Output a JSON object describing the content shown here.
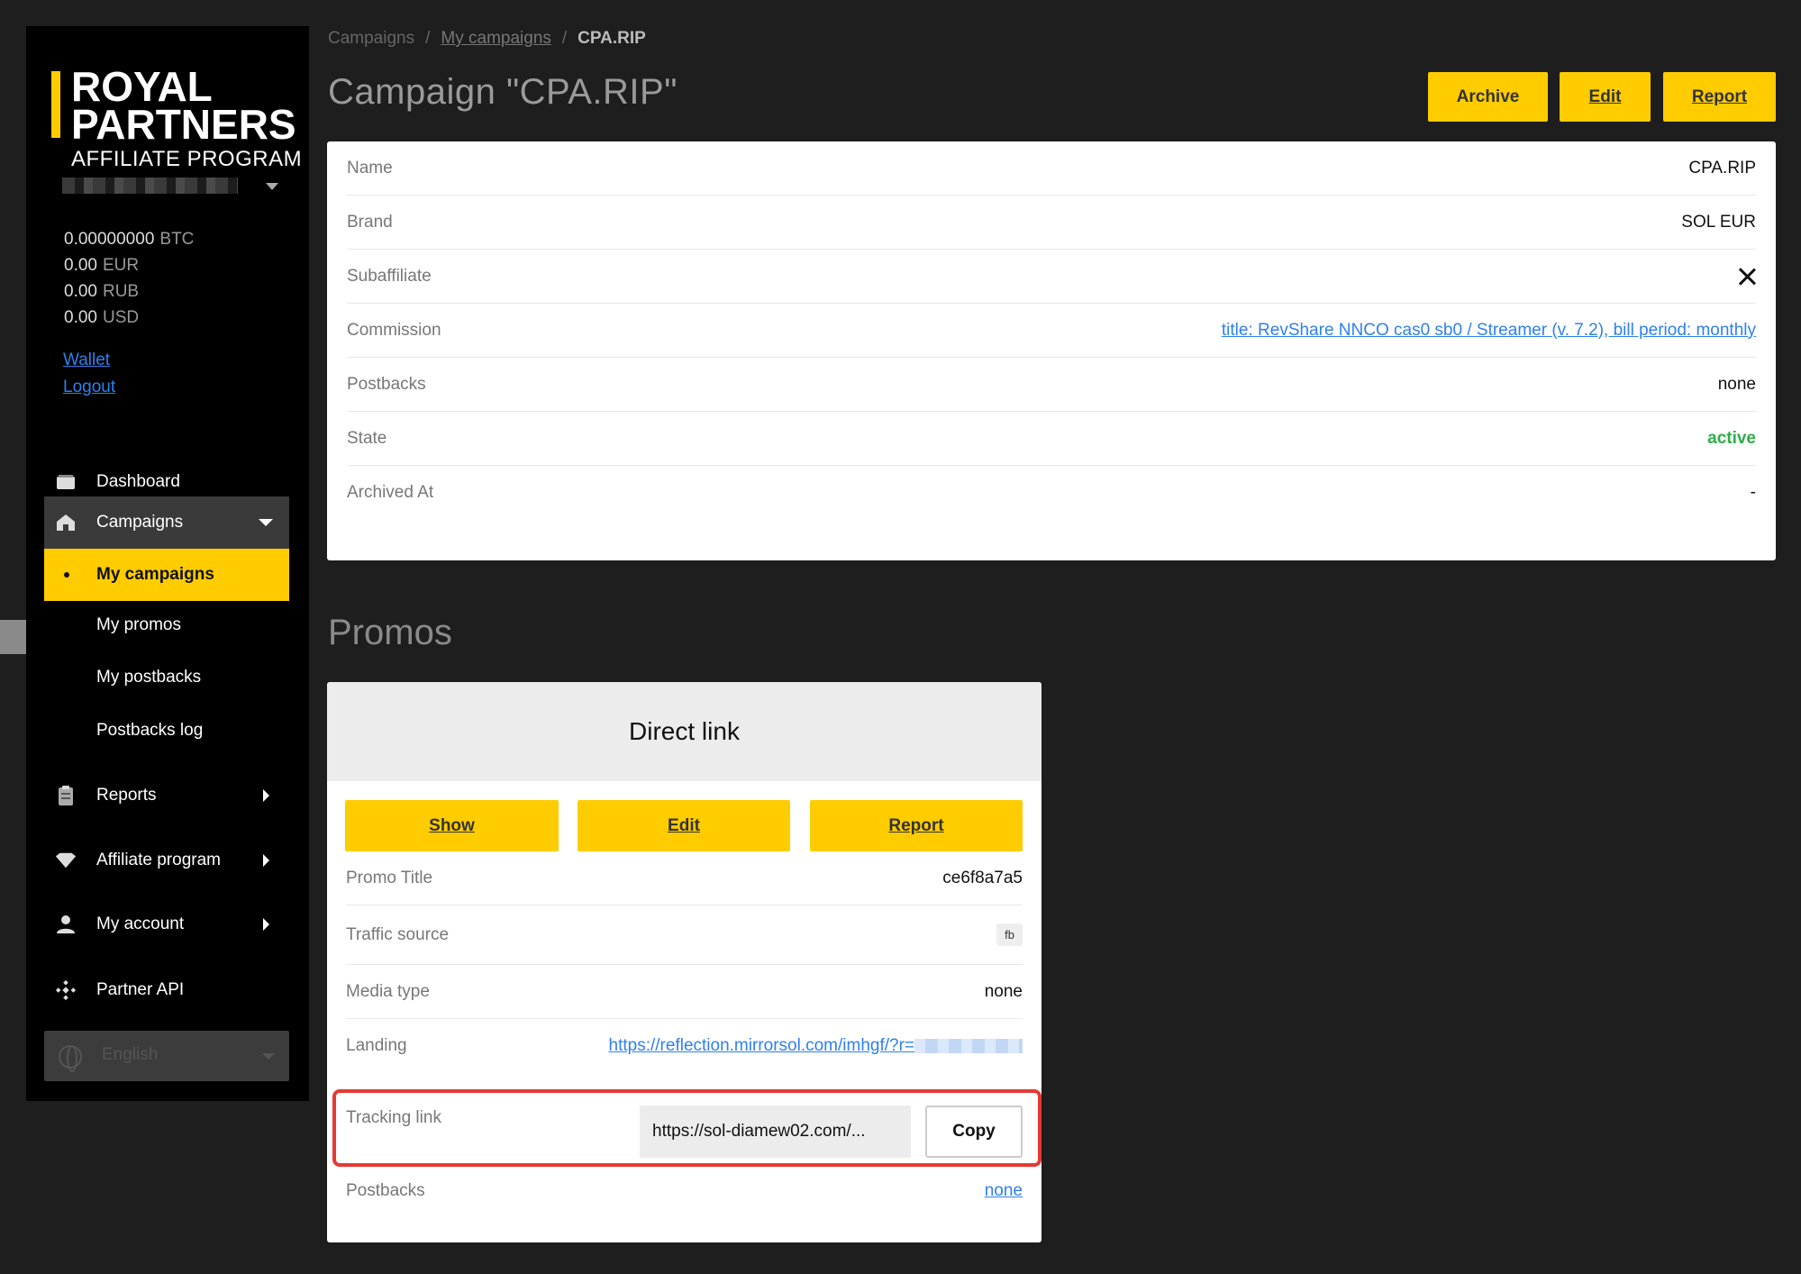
{
  "sidebar": {
    "logo": {
      "line1": "ROYAL",
      "line2": "PARTNERS",
      "line3": "AFFILIATE PROGRAM"
    },
    "balances": [
      {
        "amount": "0.00000000",
        "currency": "BTC"
      },
      {
        "amount": "0.00",
        "currency": "EUR"
      },
      {
        "amount": "0.00",
        "currency": "RUB"
      },
      {
        "amount": "0.00",
        "currency": "USD"
      }
    ],
    "links": {
      "wallet": "Wallet",
      "logout": "Logout"
    },
    "nav": {
      "dashboard": "Dashboard",
      "campaigns": "Campaigns",
      "my_campaigns": "My campaigns",
      "my_promos": "My promos",
      "my_postbacks": "My postbacks",
      "postbacks_log": "Postbacks log",
      "reports": "Reports",
      "affiliate_program": "Affiliate program",
      "my_account": "My account",
      "partner_api": "Partner API"
    },
    "language": "English"
  },
  "breadcrumb": {
    "root": "Campaigns",
    "parent": "My campaigns",
    "current": "CPA.RIP"
  },
  "page": {
    "title": "Campaign \"CPA.RIP\""
  },
  "actions": {
    "archive": "Archive",
    "edit": "Edit",
    "report": "Report"
  },
  "campaign": {
    "rows": [
      {
        "key": "Name",
        "value": "CPA.RIP"
      },
      {
        "key": "Brand",
        "value": "SOL EUR"
      },
      {
        "key": "Subaffiliate",
        "value": ""
      },
      {
        "key": "Commission",
        "value": "title: RevShare NNCO cas0 sb0 / Streamer (v. 7.2), bill period: monthly"
      },
      {
        "key": "Postbacks",
        "value": "none"
      },
      {
        "key": "State",
        "value": "active"
      },
      {
        "key": "Archived At",
        "value": "-"
      }
    ]
  },
  "promos": {
    "section_title": "Promos",
    "card_title": "Direct link",
    "buttons": {
      "show": "Show",
      "edit": "Edit",
      "report": "Report"
    },
    "promo_title": {
      "key": "Promo Title",
      "value": "ce6f8a7a5"
    },
    "traffic_source": {
      "key": "Traffic source",
      "value": "fb"
    },
    "media_type": {
      "key": "Media type",
      "value": "none"
    },
    "landing": {
      "key": "Landing",
      "value": "https://reflection.mirrorsol.com/imhgf/?r="
    },
    "tracking_link": {
      "key": "Tracking link",
      "value": "https://sol-diamew02.com/...",
      "copy_label": "Copy"
    },
    "postbacks": {
      "key": "Postbacks",
      "value": "none"
    }
  },
  "colors": {
    "accent": "#ffcc00",
    "highlight": "#e53935",
    "link": "#2f80ed",
    "active": "#2eae4a"
  }
}
